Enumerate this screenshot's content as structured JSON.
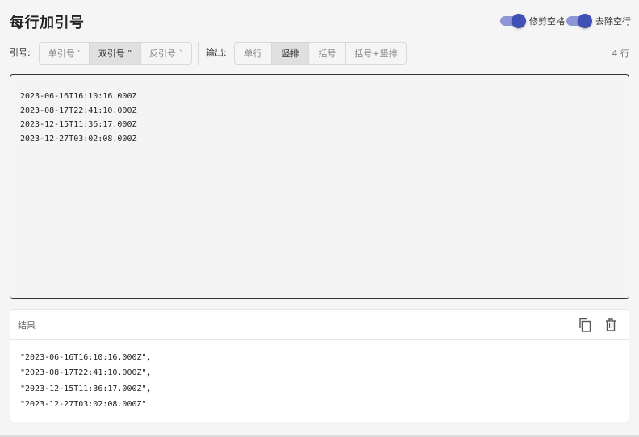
{
  "title": "每行加引号",
  "toggles": {
    "trim": {
      "label": "修剪空格",
      "on": true
    },
    "remove_empty": {
      "label": "去除空行",
      "on": true
    }
  },
  "quote": {
    "label": "引号:",
    "options": [
      "单引号 '",
      "双引号 \"",
      "反引号 `"
    ],
    "selected": "双引号 \""
  },
  "output": {
    "label": "输出:",
    "options": [
      "单行",
      "竖排",
      "括号",
      "括号+竖排"
    ],
    "selected": "竖排"
  },
  "line_count": "4 行",
  "input": {
    "lines": [
      "2023-06-16T16:10:16.000Z",
      "2023-08-17T22:41:10.000Z",
      "2023-12-15T11:36:17.000Z",
      "2023-12-27T03:02:08.000Z"
    ]
  },
  "result": {
    "title": "结果",
    "lines": [
      "\"2023-06-16T16:10:16.000Z\",",
      "\"2023-08-17T22:41:10.000Z\",",
      "\"2023-12-15T11:36:17.000Z\",",
      "\"2023-12-27T03:02:08.000Z\""
    ]
  },
  "icons": {
    "copy": "copy-icon",
    "delete": "trash-icon"
  },
  "colors": {
    "accent": "#3f51b5",
    "accent_track": "#8e96d6"
  }
}
